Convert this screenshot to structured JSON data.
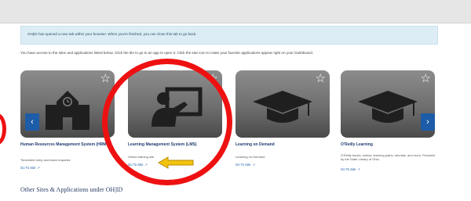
{
  "notice": {
    "text": "OH|ID has opened a new tab within your browser. When you're finished, you can close this tab to go back."
  },
  "intro": {
    "text": "You have access to the sites and applications listed below. Click the tile to go to an app to open it. Click the star icon to make your favorite applications appear right on your Dashboard."
  },
  "cards": [
    {
      "title": "Human Resources Management System (HRMS)",
      "description": "Timesheet entry and leave requests",
      "link": "Go To Site",
      "icon": "school-building-icon",
      "favorite_icon": "star-outline-icon"
    },
    {
      "title": "Learning Management System (LMS)",
      "description": "Online training site",
      "link": "Go To Site",
      "icon": "presenter-board-icon",
      "favorite_icon": "star-outline-icon"
    },
    {
      "title": "Learning on Demand",
      "description": "Learning on Demand",
      "link": "Go To Site",
      "icon": "graduation-cap-icon",
      "favorite_icon": "star-outline-icon"
    },
    {
      "title": "O'Reilly Learning",
      "description": "O'Reilly books, videos, learning paths, tutorials, and more. Provided by the State Library of Ohio.",
      "link": "Go To Site",
      "icon": "graduation-cap-icon",
      "favorite_icon": "star-outline-icon"
    }
  ],
  "carousel": {
    "prev_label": "‹",
    "next_label": "›"
  },
  "section": {
    "heading": "Other Sites & Applications under OH|ID"
  },
  "annotations": {
    "circle_color": "#ee1111",
    "arrow_color": "#f2c40f"
  },
  "colors": {
    "accent": "#1d5ca8",
    "notice_bg": "#dcedf5"
  }
}
